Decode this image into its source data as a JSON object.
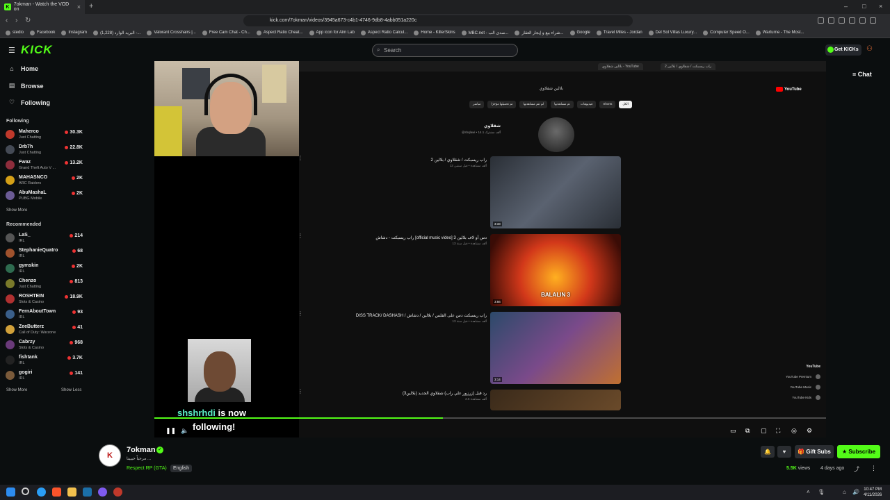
{
  "browser": {
    "tab_title": "7okman - Watch the VOD on",
    "url": "kick.com/7okman/videos/3945a673-c4b1-4746-9db8-4abb051a220c",
    "bookmarks": [
      "stedio",
      "Facebook",
      "Instagram",
      "(1,228) البريد الوارد -...",
      "Valorant Crosshairs |...",
      "Free Cam Chat - Ch...",
      "Aspect Ratio Cheat...",
      "App icon for Aim Lab",
      "Aspect Ratio Calcul...",
      "Home - KillerSkins",
      "MBC.net - صدى الب...",
      "شراء بيع و إيجار العقار...",
      "Google",
      "Travel Miles - Jordan",
      "Del Sol Villas Luxury...",
      "Computer Speed O...",
      "Warturne - The Most..."
    ]
  },
  "header": {
    "logo": "KICK",
    "search_placeholder": "Search",
    "get_kicks": "Get KICKs"
  },
  "sidebar": {
    "nav": [
      {
        "label": "Home",
        "icon": "home-icon"
      },
      {
        "label": "Browse",
        "icon": "browse-icon"
      },
      {
        "label": "Following",
        "icon": "heart-icon"
      }
    ],
    "following_title": "Following",
    "following": [
      {
        "name": "Maherco",
        "category": "Just Chatting",
        "viewers": "30.3K",
        "color": "#c0392b"
      },
      {
        "name": "Drb7h",
        "category": "Just Chatting",
        "viewers": "22.8K",
        "color": "#444a55"
      },
      {
        "name": "Fwaz",
        "category": "Grand Theft Auto V ...",
        "viewers": "13.2K",
        "color": "#8e2d3c"
      },
      {
        "name": "MAHASNCO",
        "category": "ARC Raiders",
        "viewers": "2K",
        "color": "#d4a017"
      },
      {
        "name": "AbuMashaL",
        "category": "PUBG Mobile",
        "viewers": "2K",
        "color": "#6b5b95"
      }
    ],
    "show_more": "Show More",
    "recommended_title": "Recommended",
    "recommended": [
      {
        "name": "LaS_",
        "category": "IRL",
        "viewers": "214",
        "color": "#555"
      },
      {
        "name": "StephanieQuatro",
        "category": "IRL",
        "viewers": "68",
        "color": "#a0522d"
      },
      {
        "name": "gymskin",
        "category": "IRL",
        "viewers": "2K",
        "color": "#2e6b4f"
      },
      {
        "name": "Chenzo",
        "category": "Just Chatting",
        "viewers": "813",
        "color": "#7a7a2a"
      },
      {
        "name": "ROSHTEIN",
        "category": "Slots & Casino",
        "viewers": "18.9K",
        "color": "#b03030"
      },
      {
        "name": "FernAboutTown",
        "category": "IRL",
        "viewers": "93",
        "color": "#3a5f8a"
      },
      {
        "name": "ZeeButterz",
        "category": "Call of Duty: Warzone",
        "viewers": "41",
        "color": "#d1a13a"
      },
      {
        "name": "Cabrzy",
        "category": "Slots & Casino",
        "viewers": "968",
        "color": "#6a3a7a"
      },
      {
        "name": "fishtank",
        "category": "IRL",
        "viewers": "3.7K",
        "color": "#222"
      },
      {
        "name": "gogiri",
        "category": "IRL",
        "viewers": "141",
        "color": "#7a5a3a"
      }
    ],
    "show_more_2": "Show More",
    "show_less": "Show Less"
  },
  "video": {
    "yt_search": "بلالين شقلاوي",
    "chips": [
      "الكل",
      "Shorts",
      "فيديوهات",
      "تم مشاهدتها",
      "لم تتم مشاهدتها",
      "تم تحميلها مؤخرًا",
      "مباشر"
    ],
    "channel_name": "شقلاوي",
    "channel_sub": "‎@shqlawi • 14.1 ألف مشترك",
    "results": [
      {
        "title": "راب ريسبكت / شقلاوي / بلالين 2",
        "meta": "12 ألف مشاهدة • قبل سنتين",
        "duration": "3:33"
      },
      {
        "title": "راب ريسبكت - دشاش [official music video] دس أو لاف بلالين 3",
        "meta": "13 ألف مشاهدة • قبل سنة",
        "duration": "3:56"
      },
      {
        "title": "DISS TRACK/ DASHASH / راب ريسبكت دس على الفلس / بلالين / دشاش",
        "meta": "13 ألف مشاهدة • قبل سنة",
        "duration": "3:14"
      },
      {
        "title": "رد قبل (زرزور علي راب) شقلاوي الجديد (بلالين3)",
        "meta": "2.6 ألف مشاهدة",
        "duration": ""
      }
    ],
    "thumb2_text": "BALALIN 3",
    "yt_sidebar_heading": "YouTube",
    "yt_sidebar_items": [
      "YouTube Premium",
      "YouTube Music",
      "YouTube Kids"
    ],
    "alert_user": "shshrhdi",
    "alert_text": " is now",
    "alert_line2": "following!",
    "progress": 0.43
  },
  "chat_button": "Chat",
  "channel": {
    "name": "7okman",
    "subtitle": "مرحباً حبيبنا ...",
    "category": "Respect RP (GTA)",
    "language": "English",
    "gift_label": "Gift Subs",
    "subscribe_label": "Subscribe",
    "views_count": "5.5K",
    "views_label": " views",
    "ago": "4 days ago"
  },
  "taskbar": {
    "time": "10:47 PM",
    "date": "4/11/2026"
  }
}
